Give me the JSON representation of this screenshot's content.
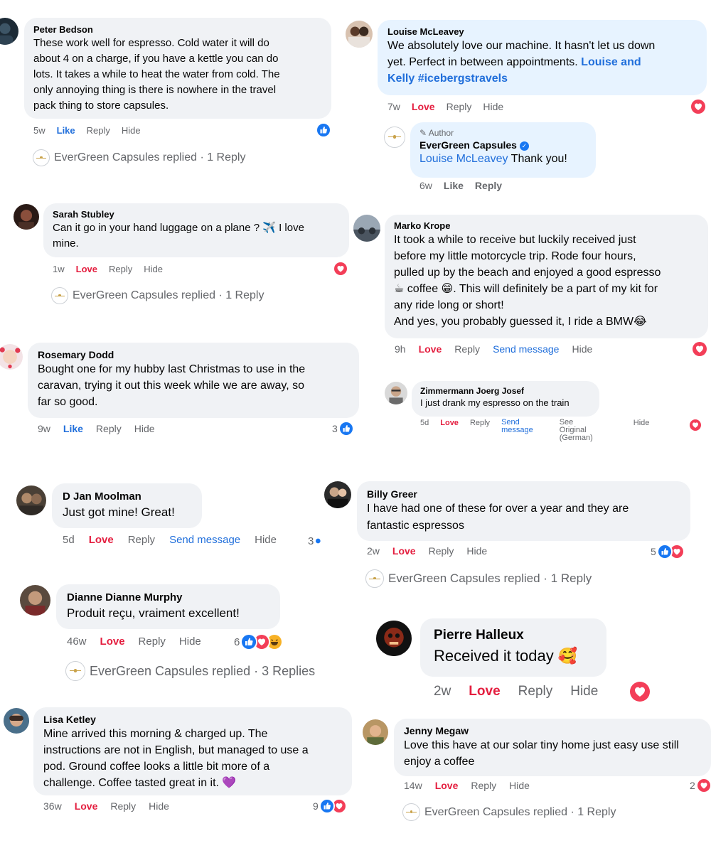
{
  "actions": {
    "love": "Love",
    "like": "Like",
    "reply": "Reply",
    "hide": "Hide",
    "send_message": "Send message",
    "send_message_stacked": "Send\nmessage",
    "see_original": "See Original\n(German)"
  },
  "comments": [
    {
      "name": "Peter Bedson",
      "text": "These work well for espresso. Cold water it will do\nabout 4 on a charge, if you have a kettle you can do\nlots. It takes a while to heat the water from cold. The\nonly annoying thing is there is nowhere in the travel\npack thing to store capsules.",
      "time": "5w",
      "replied": "EverGreen Capsules replied · 1 Reply"
    },
    {
      "name": "Louise McLeavey",
      "text": "We absolutely love our machine. It hasn't let us down\nyet. Perfect in between appointments.",
      "mention": "Louise and\nKelly #icebergstravels",
      "time": "7w"
    },
    {
      "author_label": "Author",
      "name": "EverGreen Capsules",
      "mention": "Louise McLeavey",
      "text": "Thank you!",
      "time": "6w"
    },
    {
      "name": "Sarah Stubley",
      "text": "Can it go in your hand luggage on a plane ? ✈️ I love\nmine.",
      "time": "1w",
      "replied": "EverGreen Capsules replied · 1 Reply"
    },
    {
      "name": "Marko Krope",
      "text": "It took a while to receive but luckily received just\nbefore my little motorcycle trip. Rode four hours,\npulled up by the beach and enjoyed a good espresso\n☕ coffee 😁. This will definitely be a part of my kit for\nany ride long or short!\nAnd yes, you probably guessed it, I ride a BMW😂",
      "time": "9h"
    },
    {
      "name": "Rosemary Dodd",
      "text": "Bought one for my hubby last Christmas to use in the\ncaravan, trying it out this week while we are away, so\nfar so good.",
      "time": "9w",
      "reaction_count": "3"
    },
    {
      "name": "Zimmermann Joerg Josef",
      "text": "I just drank my espresso on the train",
      "time": "5d"
    },
    {
      "name": "D Jan Moolman",
      "text": "Just got mine! Great!",
      "time": "5d",
      "reaction_count": "3"
    },
    {
      "name": "Billy Greer",
      "text": "I have had one of these for over a year and they are\nfantastic espressos",
      "time": "2w",
      "reaction_count": "5",
      "replied": "EverGreen Capsules replied · 1 Reply"
    },
    {
      "name": "Dianne Dianne Murphy",
      "text": "Produit reçu, vraiment excellent!",
      "time": "46w",
      "reaction_count": "6",
      "replied": "EverGreen Capsules replied · 3 Replies"
    },
    {
      "name": "Pierre Halleux",
      "text": "Received it today 🥰",
      "time": "2w"
    },
    {
      "name": "Lisa Ketley",
      "text": "Mine arrived this morning & charged up. The\ninstructions are not in English, but managed to use a\npod. Ground coffee looks a little bit more of a\nchallenge. Coffee tasted great in it. 💜",
      "time": "36w",
      "reaction_count": "9"
    },
    {
      "name": "Jenny Megaw",
      "text": "Love this have at our solar tiny home just easy use still\nenjoy a coffee",
      "time": "14w",
      "reaction_count": "2",
      "replied": "EverGreen Capsules replied · 1 Reply"
    }
  ],
  "colors": {
    "bubble": "#f0f2f5",
    "author_bubble": "#e7f3ff",
    "love": "#e41e3f",
    "like": "#216fdb",
    "meta": "#65676b"
  }
}
